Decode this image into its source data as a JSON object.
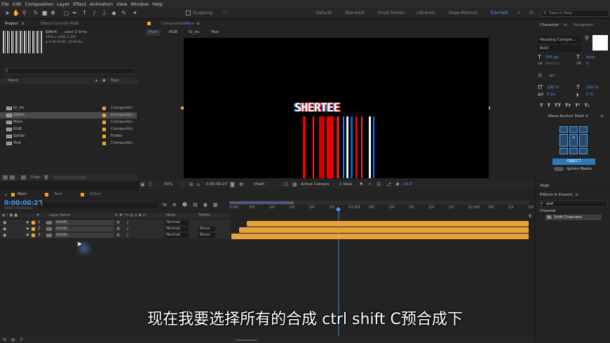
{
  "menu": [
    "File",
    "Edit",
    "Composition",
    "Layer",
    "Effect",
    "Animation",
    "View",
    "Window",
    "Help"
  ],
  "toolbar": {
    "snapping_label": "Snapping",
    "workspaces": [
      "Default",
      "Standard",
      "Small Screen",
      "Libraries",
      "Dope Motions",
      "Tutorials"
    ],
    "active_workspace": "Tutorials",
    "search_help_placeholder": "Search Help"
  },
  "project_panel": {
    "tab_label": "Project",
    "effect_controls_tab": "Effect Controls RGB",
    "selected_name": "Glitch",
    "used_text": ", used 1 time",
    "meta_line1": "1920 x 1080 (1.00)",
    "meta_line2": "Δ 0:00:10:00, 30.00 fps",
    "search_placeholder": "",
    "col_name": "Name",
    "col_type": "Type",
    "items": [
      {
        "name": "Gl_its",
        "type": "Compositio"
      },
      {
        "name": "Glitch",
        "type": "Compositio",
        "selected": true
      },
      {
        "name": "Main",
        "type": "Compositio"
      },
      {
        "name": "RGB",
        "type": "Compositio"
      },
      {
        "name": "Solids",
        "type": "Folder"
      },
      {
        "name": "Text",
        "type": "Compositio"
      }
    ],
    "bpc": "8 bpc"
  },
  "composition_panel": {
    "tab_label": "Composition",
    "tab_comp": "Main",
    "breadcrumbs": [
      "Main",
      "RGB",
      "Gl_its",
      "Text"
    ],
    "glitch_text": "SHERTEE",
    "footer": {
      "zoom": "50%",
      "timecode": "0:00:00:27",
      "resolution": "(Half)",
      "camera": "Active Camera",
      "view": "1 View",
      "exposure": "+0.0"
    }
  },
  "character_panel": {
    "tab_character": "Character",
    "tab_paragraph": "Paragraph",
    "font": "Heading Compre...",
    "style": "Bold",
    "size": "165 px",
    "leading": "Auto",
    "kerning": "Metrics",
    "tracking": "0",
    "stroke": "px",
    "vscale": "100 %",
    "hscale": "100 %",
    "baseline": "0 px",
    "tsume": "0 %",
    "styles": [
      "T",
      "T",
      "TT",
      "Tт",
      "T¹",
      "T₁"
    ]
  },
  "anchor_panel": {
    "title": "Move Anchor Point 4",
    "object_button": "OBJECT",
    "ignore_masks": "Ignore Masks"
  },
  "align_panel": {
    "title": "Align"
  },
  "effects_panel": {
    "title": "Effects & Presets",
    "search_value": "shif",
    "category": "Channel",
    "result": "Shift Channels"
  },
  "timeline": {
    "tabs": [
      "Main",
      "Text",
      "Glitch"
    ],
    "timecode": "0:00:00:27",
    "fps_line": "00027 (30.00 fps)",
    "col_layer_name": "Layer Name",
    "col_mode": "Mode",
    "col_trkmat": "TrkMat",
    "layers": [
      {
        "num": "1",
        "name": "[RGB]",
        "mode": "Normal",
        "trkmat": ""
      },
      {
        "num": "2",
        "name": "[RGB]",
        "mode": "Normal",
        "trkmat": "None"
      },
      {
        "num": "3",
        "name": "[RGB]",
        "mode": "Normal",
        "trkmat": "None"
      }
    ],
    "ruler_ticks": [
      "0:00f",
      "05f",
      "10f",
      "15f",
      "20f",
      "25f",
      "01:00f",
      "05f",
      "10f",
      "15f",
      "20f",
      "25f",
      "02:00f",
      "05f",
      "10f",
      "15f"
    ]
  },
  "subtitle": "现在我要选择所有的合成 ctrl shift C预合成下",
  "colors": {
    "accent": "#4a9cff",
    "label_orange": "#f5a623",
    "track": "#e6a23b",
    "object_button": "#2a7bbd"
  }
}
